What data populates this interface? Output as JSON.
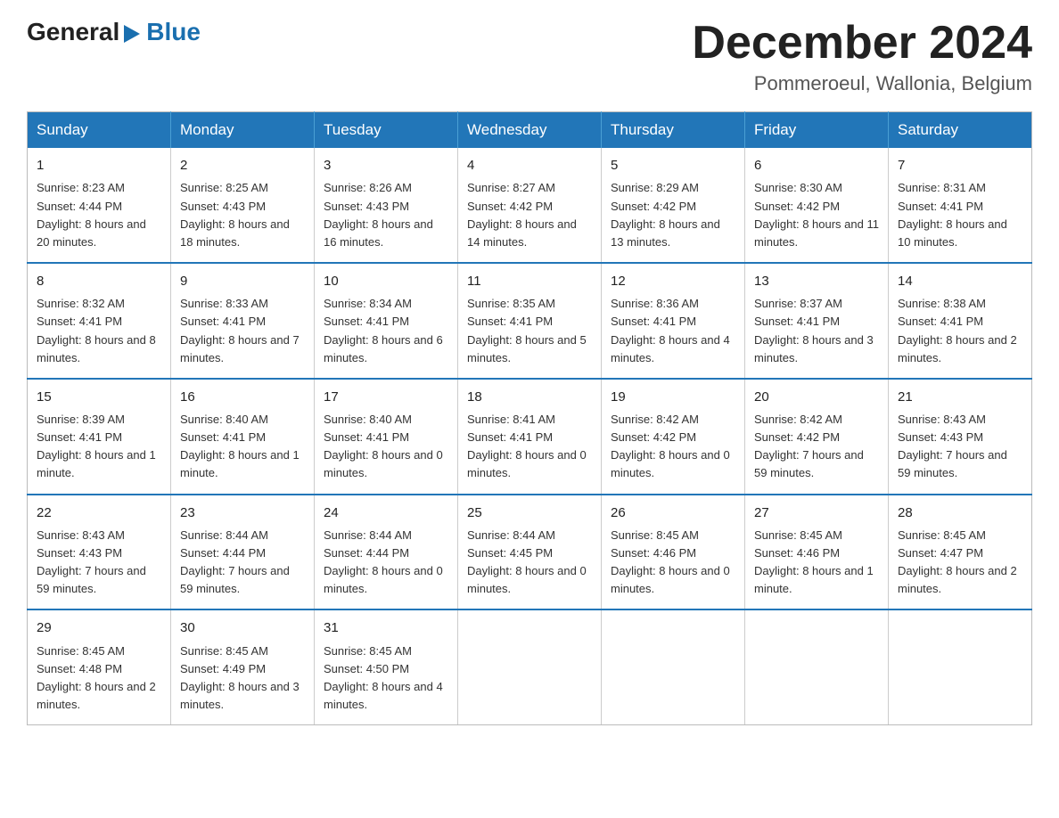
{
  "header": {
    "logo_general": "General",
    "logo_blue": "Blue",
    "month_title": "December 2024",
    "location": "Pommeroeul, Wallonia, Belgium"
  },
  "weekdays": [
    "Sunday",
    "Monday",
    "Tuesday",
    "Wednesday",
    "Thursday",
    "Friday",
    "Saturday"
  ],
  "weeks": [
    [
      {
        "day": "1",
        "sunrise": "8:23 AM",
        "sunset": "4:44 PM",
        "daylight": "8 hours and 20 minutes."
      },
      {
        "day": "2",
        "sunrise": "8:25 AM",
        "sunset": "4:43 PM",
        "daylight": "8 hours and 18 minutes."
      },
      {
        "day": "3",
        "sunrise": "8:26 AM",
        "sunset": "4:43 PM",
        "daylight": "8 hours and 16 minutes."
      },
      {
        "day": "4",
        "sunrise": "8:27 AM",
        "sunset": "4:42 PM",
        "daylight": "8 hours and 14 minutes."
      },
      {
        "day": "5",
        "sunrise": "8:29 AM",
        "sunset": "4:42 PM",
        "daylight": "8 hours and 13 minutes."
      },
      {
        "day": "6",
        "sunrise": "8:30 AM",
        "sunset": "4:42 PM",
        "daylight": "8 hours and 11 minutes."
      },
      {
        "day": "7",
        "sunrise": "8:31 AM",
        "sunset": "4:41 PM",
        "daylight": "8 hours and 10 minutes."
      }
    ],
    [
      {
        "day": "8",
        "sunrise": "8:32 AM",
        "sunset": "4:41 PM",
        "daylight": "8 hours and 8 minutes."
      },
      {
        "day": "9",
        "sunrise": "8:33 AM",
        "sunset": "4:41 PM",
        "daylight": "8 hours and 7 minutes."
      },
      {
        "day": "10",
        "sunrise": "8:34 AM",
        "sunset": "4:41 PM",
        "daylight": "8 hours and 6 minutes."
      },
      {
        "day": "11",
        "sunrise": "8:35 AM",
        "sunset": "4:41 PM",
        "daylight": "8 hours and 5 minutes."
      },
      {
        "day": "12",
        "sunrise": "8:36 AM",
        "sunset": "4:41 PM",
        "daylight": "8 hours and 4 minutes."
      },
      {
        "day": "13",
        "sunrise": "8:37 AM",
        "sunset": "4:41 PM",
        "daylight": "8 hours and 3 minutes."
      },
      {
        "day": "14",
        "sunrise": "8:38 AM",
        "sunset": "4:41 PM",
        "daylight": "8 hours and 2 minutes."
      }
    ],
    [
      {
        "day": "15",
        "sunrise": "8:39 AM",
        "sunset": "4:41 PM",
        "daylight": "8 hours and 1 minute."
      },
      {
        "day": "16",
        "sunrise": "8:40 AM",
        "sunset": "4:41 PM",
        "daylight": "8 hours and 1 minute."
      },
      {
        "day": "17",
        "sunrise": "8:40 AM",
        "sunset": "4:41 PM",
        "daylight": "8 hours and 0 minutes."
      },
      {
        "day": "18",
        "sunrise": "8:41 AM",
        "sunset": "4:41 PM",
        "daylight": "8 hours and 0 minutes."
      },
      {
        "day": "19",
        "sunrise": "8:42 AM",
        "sunset": "4:42 PM",
        "daylight": "8 hours and 0 minutes."
      },
      {
        "day": "20",
        "sunrise": "8:42 AM",
        "sunset": "4:42 PM",
        "daylight": "7 hours and 59 minutes."
      },
      {
        "day": "21",
        "sunrise": "8:43 AM",
        "sunset": "4:43 PM",
        "daylight": "7 hours and 59 minutes."
      }
    ],
    [
      {
        "day": "22",
        "sunrise": "8:43 AM",
        "sunset": "4:43 PM",
        "daylight": "7 hours and 59 minutes."
      },
      {
        "day": "23",
        "sunrise": "8:44 AM",
        "sunset": "4:44 PM",
        "daylight": "7 hours and 59 minutes."
      },
      {
        "day": "24",
        "sunrise": "8:44 AM",
        "sunset": "4:44 PM",
        "daylight": "8 hours and 0 minutes."
      },
      {
        "day": "25",
        "sunrise": "8:44 AM",
        "sunset": "4:45 PM",
        "daylight": "8 hours and 0 minutes."
      },
      {
        "day": "26",
        "sunrise": "8:45 AM",
        "sunset": "4:46 PM",
        "daylight": "8 hours and 0 minutes."
      },
      {
        "day": "27",
        "sunrise": "8:45 AM",
        "sunset": "4:46 PM",
        "daylight": "8 hours and 1 minute."
      },
      {
        "day": "28",
        "sunrise": "8:45 AM",
        "sunset": "4:47 PM",
        "daylight": "8 hours and 2 minutes."
      }
    ],
    [
      {
        "day": "29",
        "sunrise": "8:45 AM",
        "sunset": "4:48 PM",
        "daylight": "8 hours and 2 minutes."
      },
      {
        "day": "30",
        "sunrise": "8:45 AM",
        "sunset": "4:49 PM",
        "daylight": "8 hours and 3 minutes."
      },
      {
        "day": "31",
        "sunrise": "8:45 AM",
        "sunset": "4:50 PM",
        "daylight": "8 hours and 4 minutes."
      },
      null,
      null,
      null,
      null
    ]
  ],
  "labels": {
    "sunrise": "Sunrise:",
    "sunset": "Sunset:",
    "daylight": "Daylight:"
  }
}
